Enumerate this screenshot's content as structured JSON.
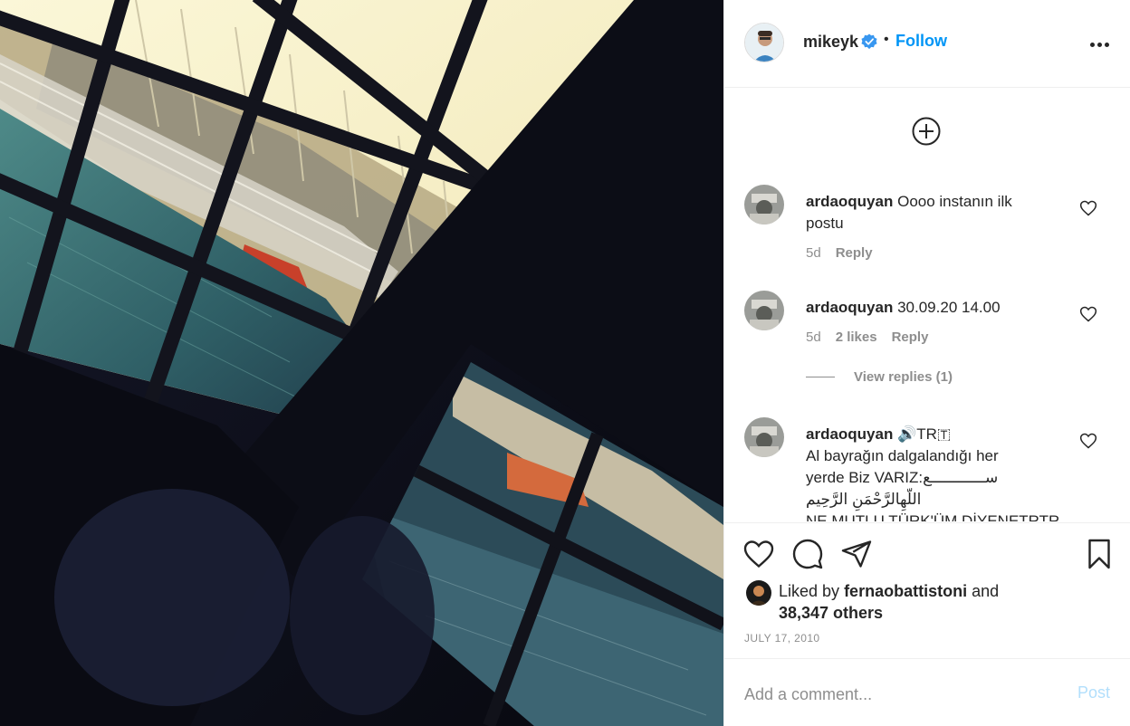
{
  "post": {
    "author": {
      "username": "mikeyk",
      "verified": true,
      "follow_label": "Follow",
      "separator": "•"
    },
    "image": {
      "alt": "Photo of a marina through a window, tilted view"
    }
  },
  "comments": [
    {
      "username": "ardaoquyan",
      "text": "Oooo instanın ilk postu",
      "time": "5d",
      "likes": "",
      "reply_label": "Reply"
    },
    {
      "username": "ardaoquyan",
      "text": "30.09.20 14.00",
      "time": "5d",
      "likes": "2 likes",
      "reply_label": "Reply",
      "view_replies": "View replies (1)"
    },
    {
      "username": "ardaoquyan",
      "text_line1": "🔊TR🇹",
      "text_line2": "Al bayrağın dalgalandığı her",
      "text_line3": "yerde Biz VARIZ:ﺳــــــــــــﻊ",
      "text_line4": "اللّهِالرَّحْمَنِ الرَّحِيم",
      "text_line5": "NE MUTLU TÜRK'ÜM DİYENETRTR"
    }
  ],
  "actions": {
    "liked_by_prefix": "Liked by",
    "liked_by_user": "fernaobattistoni",
    "liked_by_and": "and",
    "liked_by_others": "38,347 others",
    "date": "JULY 17, 2010"
  },
  "add_comment": {
    "placeholder": "Add a comment...",
    "post_label": "Post"
  },
  "colors": {
    "accent": "#0095f6",
    "text": "#262626",
    "muted": "#8e8e8e",
    "post_disabled": "#b2dffc",
    "divider": "#efefef"
  },
  "icons": {
    "header_more": "more-options-icon",
    "load_more": "plus-circle-icon",
    "comment_like": "heart-outline-icon",
    "like": "heart-icon",
    "comment": "comment-bubble-icon",
    "share": "paper-plane-icon",
    "save": "bookmark-icon"
  }
}
